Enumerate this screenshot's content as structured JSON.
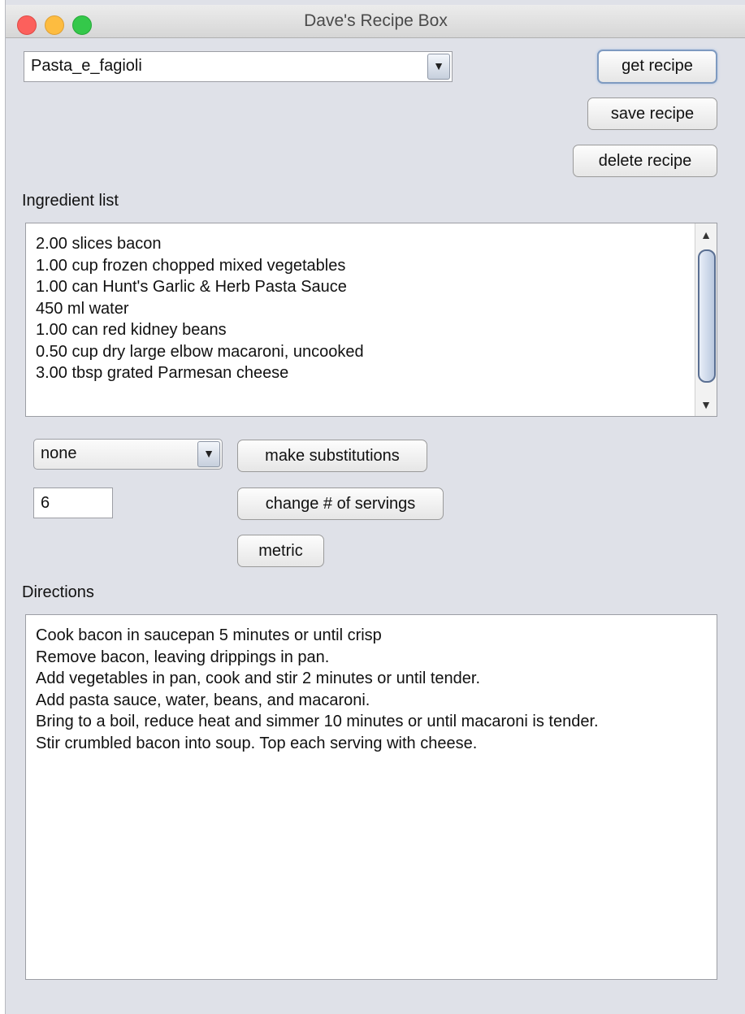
{
  "window": {
    "title": "Dave's Recipe Box"
  },
  "recipe_select": {
    "value": "Pasta_e_fagioli"
  },
  "buttons": {
    "get_recipe": "get recipe",
    "save_recipe": "save recipe",
    "delete_recipe": "delete recipe",
    "make_substitutions": "make substitutions",
    "change_servings": "change # of servings",
    "metric": "metric"
  },
  "ingredients": {
    "label": "Ingredient list",
    "items": [
      "2.00 slices bacon",
      "1.00 cup frozen chopped mixed vegetables",
      "1.00 can Hunt's Garlic & Herb Pasta Sauce",
      "450 ml water",
      "1.00 can red kidney beans",
      "0.50 cup dry large elbow macaroni, uncooked",
      "3.00 tbsp grated Parmesan cheese"
    ]
  },
  "substitution_select": {
    "value": "none"
  },
  "servings_field": {
    "value": "6"
  },
  "directions": {
    "label": "Directions",
    "lines": [
      "Cook bacon in saucepan 5 minutes or until crisp",
      "Remove bacon, leaving drippings in pan.",
      "Add vegetables in pan, cook and stir 2 minutes or until tender.",
      "Add pasta sauce, water, beans, and macaroni.",
      "Bring to a boil, reduce heat and simmer 10 minutes or until macaroni is tender.",
      "Stir crumbled bacon into soup.  Top each serving with cheese."
    ]
  },
  "icons": {
    "dropdown_arrow": "▼",
    "scroll_up": "▲",
    "scroll_down": "▼"
  },
  "colors": {
    "window_bg": "#dfe1e8",
    "close": "#fc605c",
    "minimize": "#fdbc40",
    "maximize": "#34c84a"
  }
}
